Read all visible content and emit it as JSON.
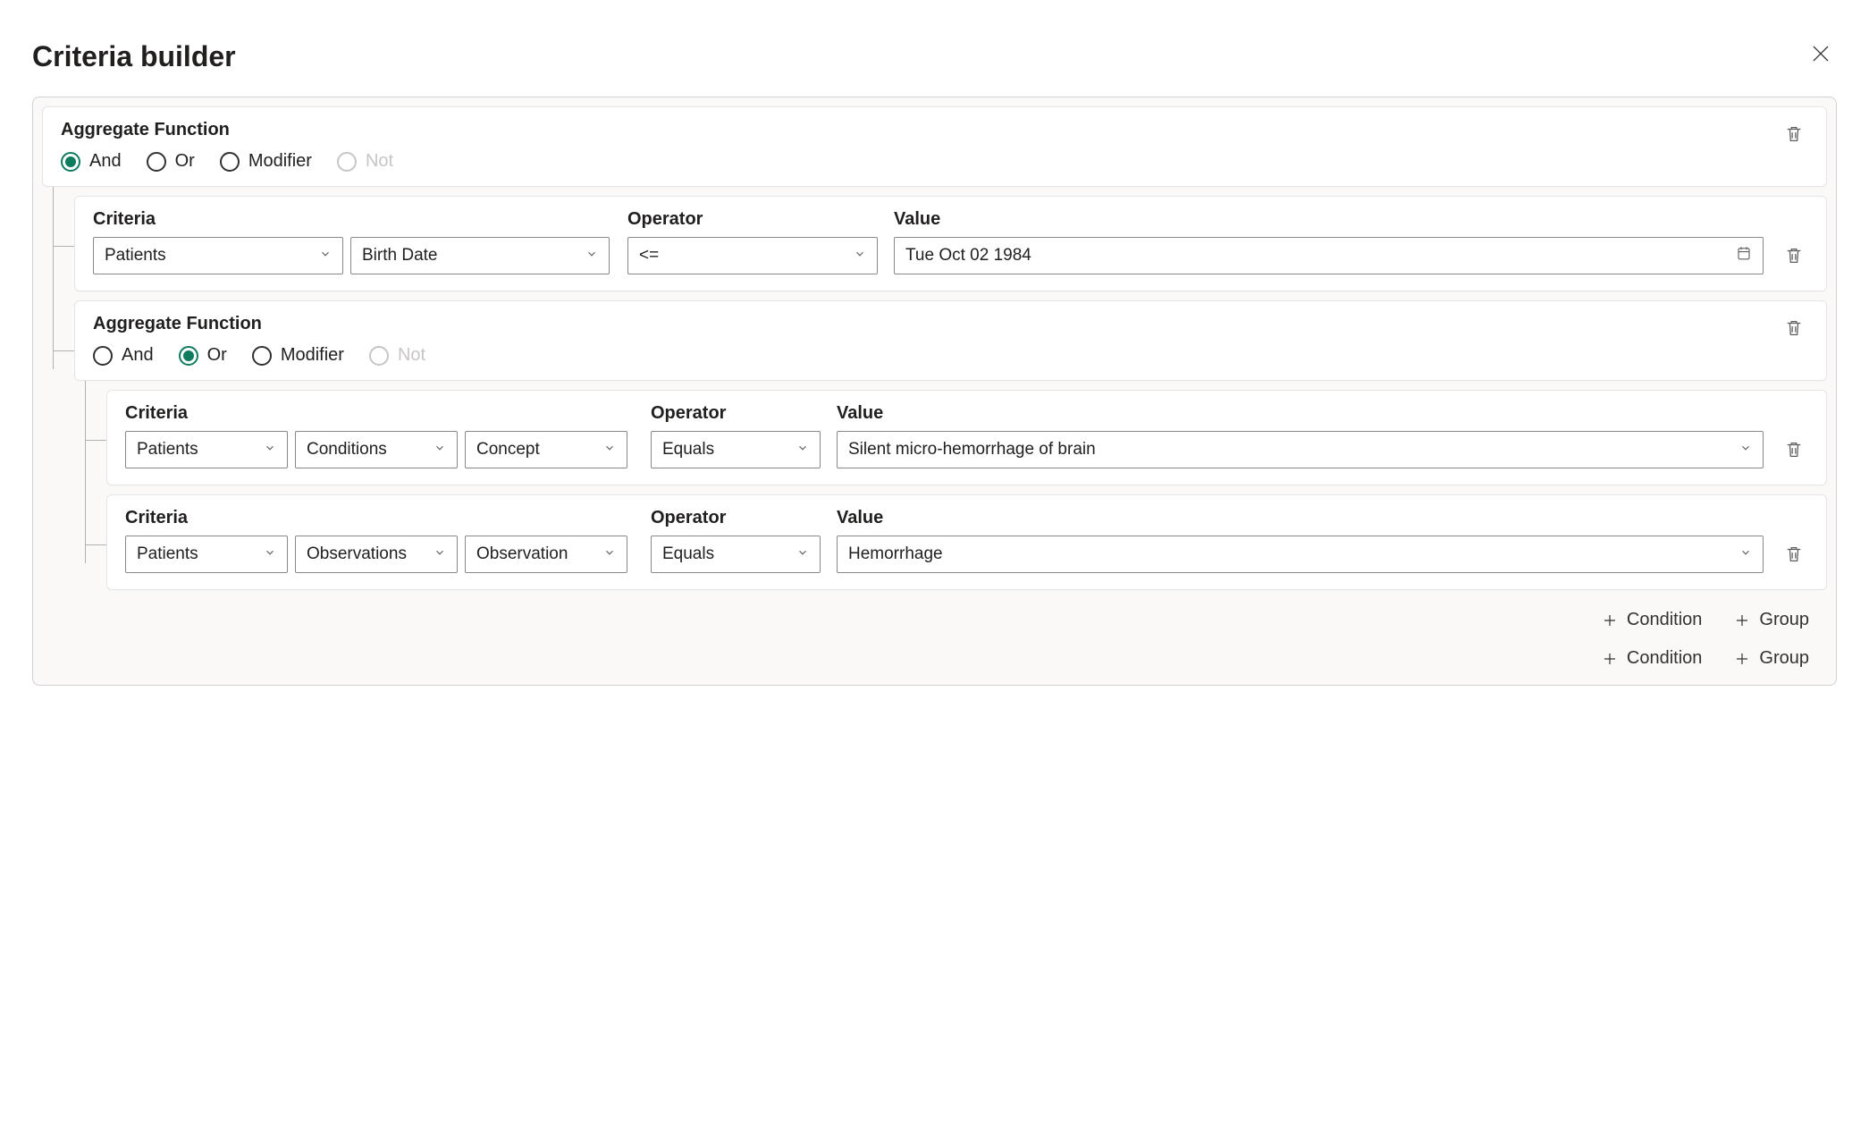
{
  "title": "Criteria builder",
  "labels": {
    "aggregate_function": "Aggregate Function",
    "criteria": "Criteria",
    "operator": "Operator",
    "value": "Value",
    "and": "And",
    "or": "Or",
    "modifier": "Modifier",
    "not": "Not",
    "condition_btn": "Condition",
    "group_btn": "Group"
  },
  "root_group": {
    "selected": "And",
    "children": [
      {
        "type": "condition",
        "criteria": [
          "Patients",
          "Birth Date"
        ],
        "operator": "<=",
        "value": "Tue Oct 02 1984",
        "value_kind": "date"
      },
      {
        "type": "group",
        "selected": "Or",
        "children": [
          {
            "type": "condition",
            "criteria": [
              "Patients",
              "Conditions",
              "Concept"
            ],
            "operator": "Equals",
            "value": "Silent micro-hemorrhage of brain",
            "value_kind": "select"
          },
          {
            "type": "condition",
            "criteria": [
              "Patients",
              "Observations",
              "Observation"
            ],
            "operator": "Equals",
            "value": "Hemorrhage",
            "value_kind": "select"
          }
        ]
      }
    ]
  }
}
